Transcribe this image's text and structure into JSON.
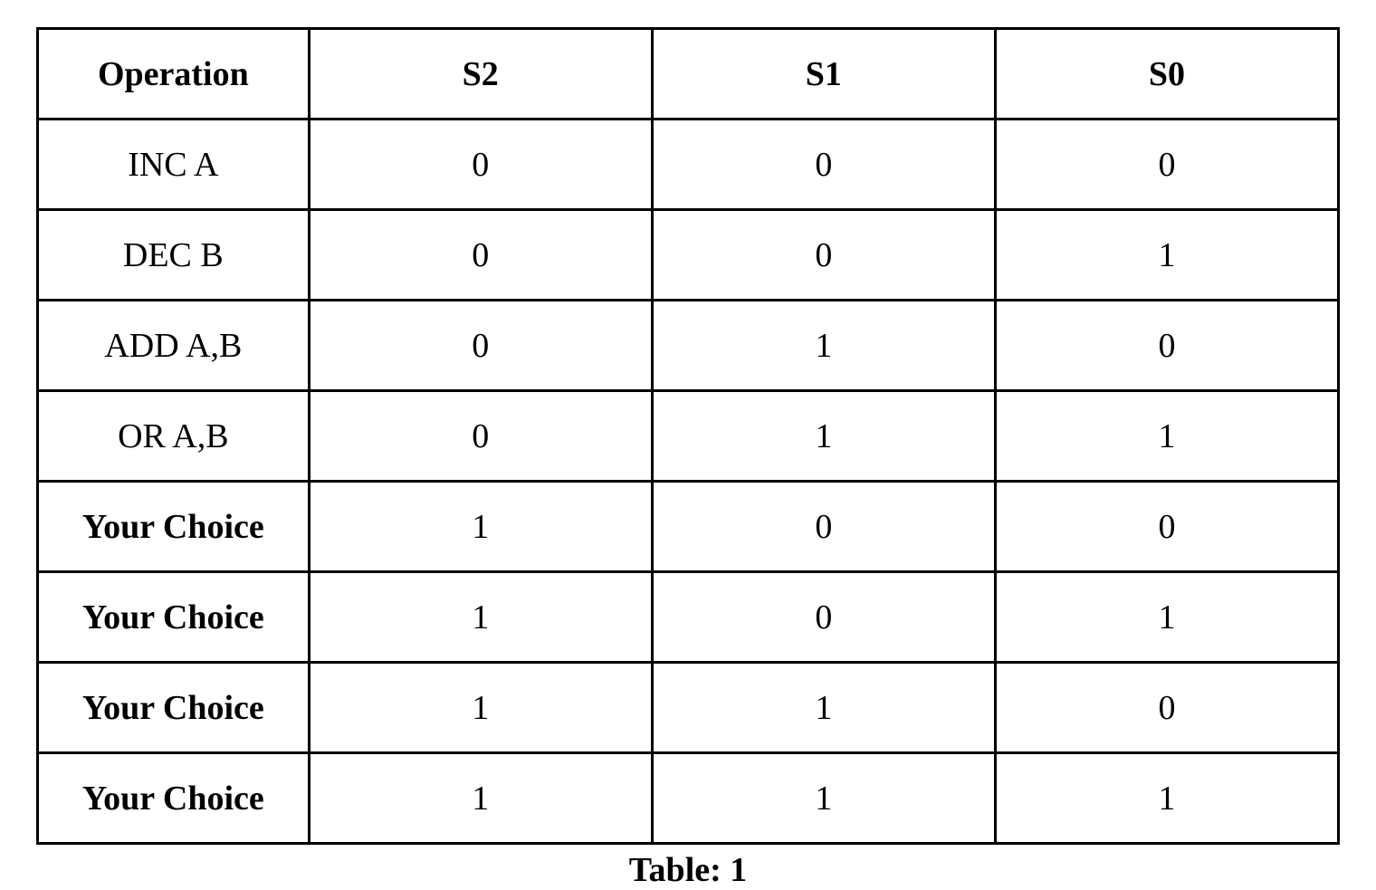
{
  "table": {
    "headers": {
      "operation": "Operation",
      "s2": "S2",
      "s1": "S1",
      "s0": "S0"
    },
    "rows": [
      {
        "operation": "INC A",
        "s2": "0",
        "s1": "0",
        "s0": "0",
        "bold": false
      },
      {
        "operation": "DEC B",
        "s2": "0",
        "s1": "0",
        "s0": "1",
        "bold": false
      },
      {
        "operation": "ADD A,B",
        "s2": "0",
        "s1": "1",
        "s0": "0",
        "bold": false
      },
      {
        "operation": "OR A,B",
        "s2": "0",
        "s1": "1",
        "s0": "1",
        "bold": false
      },
      {
        "operation": "Your Choice",
        "s2": "1",
        "s1": "0",
        "s0": "0",
        "bold": true
      },
      {
        "operation": "Your Choice",
        "s2": "1",
        "s1": "0",
        "s0": "1",
        "bold": true
      },
      {
        "operation": "Your Choice",
        "s2": "1",
        "s1": "1",
        "s0": "0",
        "bold": true
      },
      {
        "operation": "Your Choice",
        "s2": "1",
        "s1": "1",
        "s0": "1",
        "bold": true
      }
    ],
    "caption": "Table: 1"
  }
}
